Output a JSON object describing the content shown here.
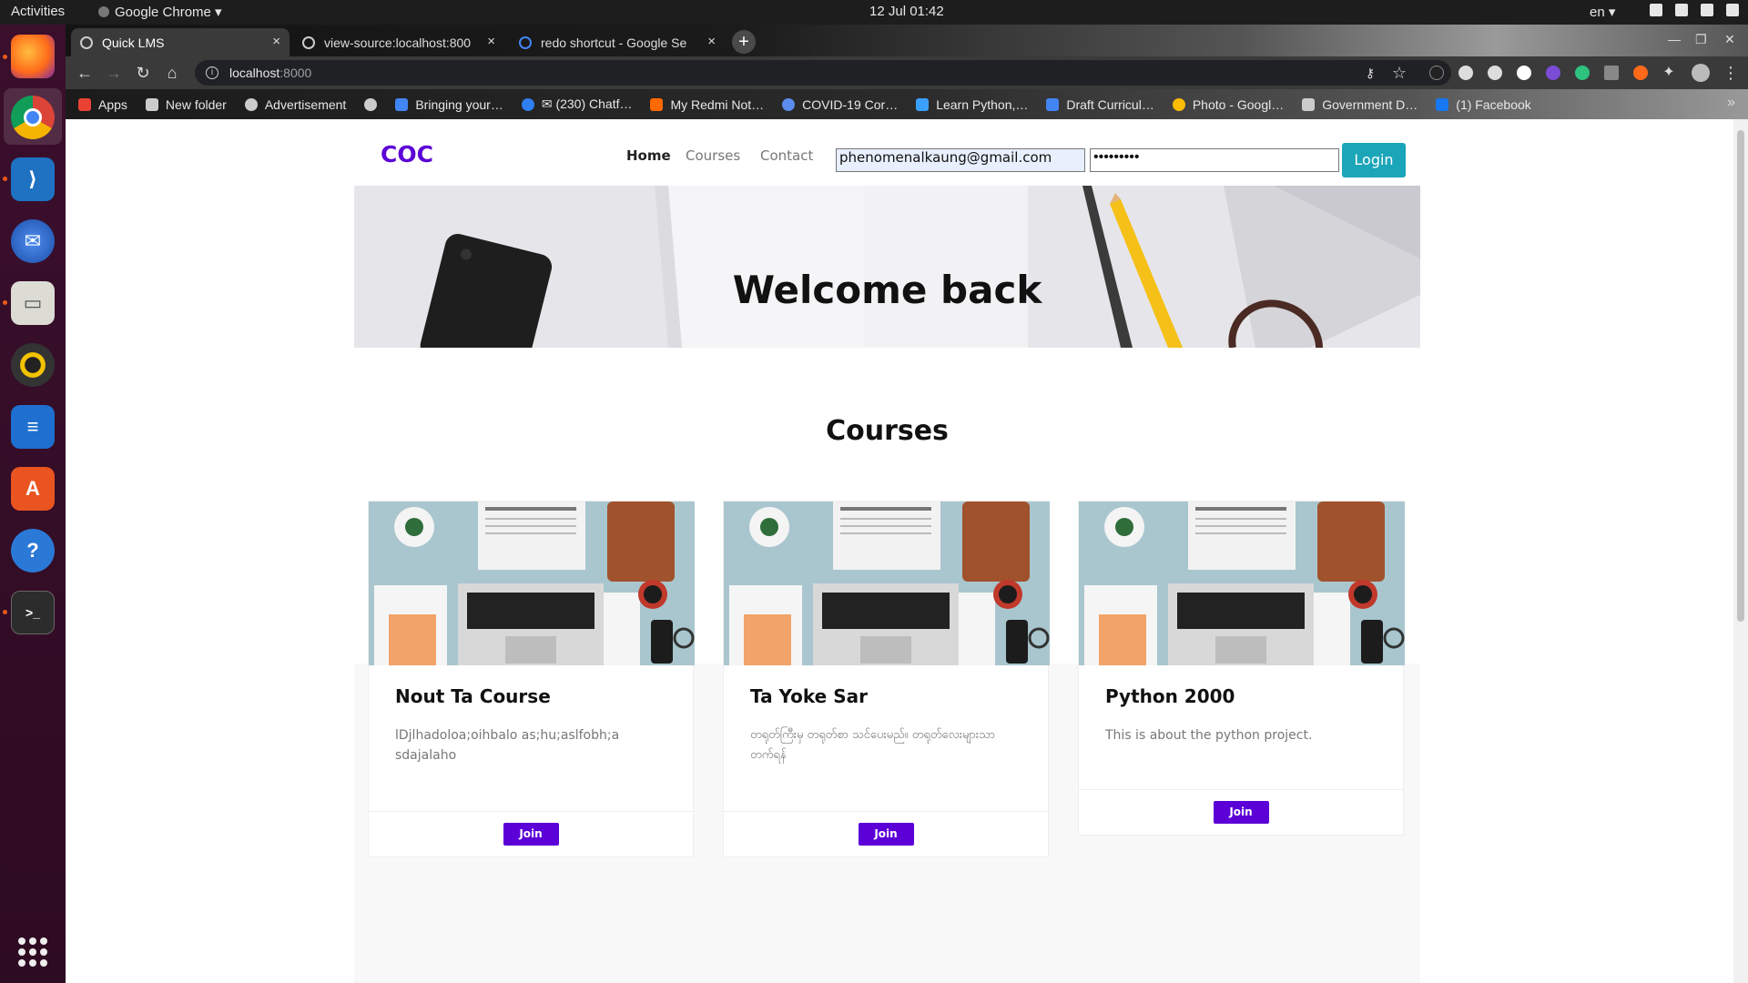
{
  "os": {
    "activities": "Activities",
    "app_menu": "Google Chrome ▾",
    "clock": "12 Jul  01:42",
    "language": "en ▾"
  },
  "browser": {
    "tabs": [
      {
        "title": "Quick LMS",
        "active": true
      },
      {
        "title": "view-source:localhost:800",
        "active": false
      },
      {
        "title": "redo shortcut - Google Se",
        "active": false
      }
    ],
    "address_host": "localhost",
    "address_port": ":8000",
    "bookmarks": [
      {
        "label": "Apps",
        "icon": "apps-grid-icon",
        "color": "#e94235"
      },
      {
        "label": "New folder",
        "icon": "folder-icon",
        "color": "#cccccc"
      },
      {
        "label": "Advertisement",
        "icon": "globe-icon",
        "color": "#cccccc"
      },
      {
        "label": "",
        "icon": "globe-icon",
        "color": "#cccccc"
      },
      {
        "label": "Bringing your…",
        "icon": "slides-icon",
        "color": "#4285f4"
      },
      {
        "label": "✉ (230) Chatf…",
        "icon": "chatfuel-icon",
        "color": "#2f7ff0"
      },
      {
        "label": "My Redmi Not…",
        "icon": "mi-icon",
        "color": "#ff6a00"
      },
      {
        "label": "COVID-19 Cor…",
        "icon": "covid-icon",
        "color": "#5b8def"
      },
      {
        "label": "Learn Python,…",
        "icon": "k-icon",
        "color": "#3aa0ff"
      },
      {
        "label": "Draft Curricul…",
        "icon": "docs-icon",
        "color": "#4285f4"
      },
      {
        "label": "Photo - Googl…",
        "icon": "photos-icon",
        "color": "#fbbc04"
      },
      {
        "label": "Government D…",
        "icon": "gov-icon",
        "color": "#cccccc"
      },
      {
        "label": "(1) Facebook",
        "icon": "facebook-icon",
        "color": "#1877f2"
      }
    ]
  },
  "site": {
    "brand": "COC",
    "nav": [
      "Home",
      "Courses",
      "Contact"
    ],
    "email_value": "phenomenalkaung@gmail.com",
    "password_value": "•••••••••",
    "login_label": "Login",
    "hero_title": "Welcome back",
    "section_title": "Courses",
    "join_label": "Join",
    "courses": [
      {
        "title": "Nout Ta Course",
        "description": "lDjlhadoloa;oihbalo as;hu;aslfobh;a sdajalaho"
      },
      {
        "title": "Ta Yoke Sar",
        "description": "တရုတ်ကြီးမှ တရုတ်စာ သင်ပေးမည်။ တရုတ်လေးများသာ တက်ရန်"
      },
      {
        "title": "Python 2000",
        "description": "This is about the python project."
      }
    ]
  },
  "colors": {
    "brand": "#5b00d6",
    "login_button": "#1ba5b8",
    "join_button": "#5b00d6"
  }
}
